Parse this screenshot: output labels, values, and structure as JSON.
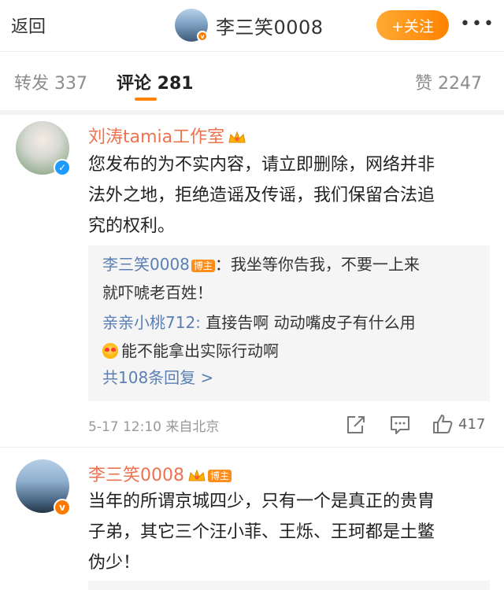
{
  "header": {
    "back_label": "返回",
    "user_name": "李三笑0008",
    "follow_label": "+关注",
    "more_label": "•••"
  },
  "tabs": {
    "repost": "转发 337",
    "comment": "评论 281",
    "like": "赞 2247"
  },
  "comments": [
    {
      "name": "刘涛tamia工作室",
      "content": [
        "您发布的为不实内容，请立即删除，网络并非",
        "法外之地，拒绝造谣及传谣，我们保留合法追",
        "究的权利。"
      ],
      "replies": [
        {
          "name": "李三笑0008",
          "tag": "博主",
          "line1": "：我坐等你告我，不要一上来",
          "line2": "就吓唬老百姓！"
        },
        {
          "name": "亲亲小桃712:",
          "line1": " 直接告啊 动动嘴皮子有什么用",
          "line2": "能不能拿出实际行动啊"
        }
      ],
      "more_replies": "共108条回复 >",
      "meta": "5-17 12:10 来自北京",
      "like_count": "417"
    },
    {
      "name": "李三笑0008",
      "tag": "博主",
      "content": [
        "当年的所谓京城四少，只有一个是真正的贵胄",
        "子弟，其它三个汪小菲、王烁、王珂都是土鳖",
        "伪少！"
      ]
    }
  ],
  "colors": {
    "accent": "#ff8200",
    "name_orange": "#eb7350",
    "link_blue": "#5a7fb5",
    "verify_blue": "#1f9aff"
  },
  "icons": [
    "crown-icon",
    "verified-icon",
    "share-icon",
    "comment-icon",
    "like-icon",
    "emoji-icon"
  ]
}
